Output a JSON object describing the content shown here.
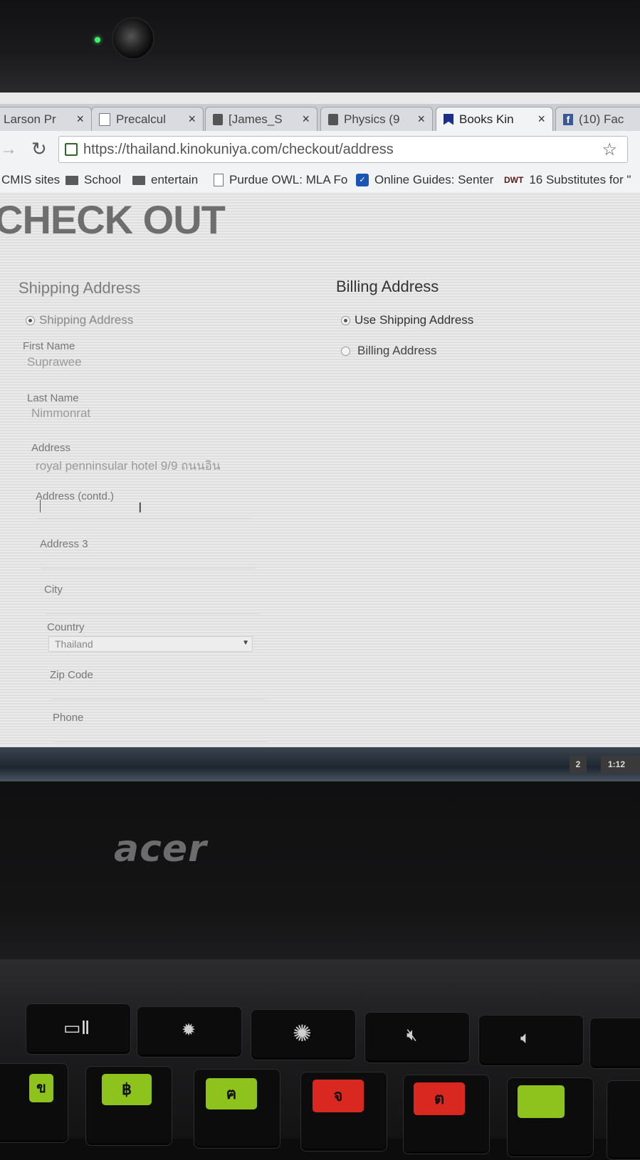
{
  "browser": {
    "tabs": [
      {
        "title": "Larson Pr",
        "favicon": "doc-icon",
        "active": false
      },
      {
        "title": "Precalcul",
        "favicon": "doc-icon",
        "active": false
      },
      {
        "title": "[James_S",
        "favicon": "image-icon",
        "active": false
      },
      {
        "title": "Physics (9",
        "favicon": "image-icon",
        "active": false
      },
      {
        "title": "Books Kin",
        "favicon": "bookmark-icon",
        "active": true
      },
      {
        "title": "(10) Fac",
        "favicon": "facebook-icon",
        "active": false
      }
    ],
    "tab_close_glyph": "×",
    "url": "https://thailand.kinokuniya.com/checkout/address",
    "bookmarks": [
      {
        "label": "CMIS sites",
        "icon": "none"
      },
      {
        "label": "School",
        "icon": "folder-icon"
      },
      {
        "label": "entertain",
        "icon": "folder-icon"
      },
      {
        "label": "Purdue OWL: MLA Fo",
        "icon": "doc-icon"
      },
      {
        "label": "Online Guides: Senter",
        "icon": "guide-icon"
      },
      {
        "label": "16 Substitutes for \"",
        "icon": "dwt-icon",
        "icon_text": "DWT"
      }
    ]
  },
  "checkout": {
    "title": "CHECK OUT",
    "shipping": {
      "heading": "Shipping Address",
      "radio_label": "Shipping Address",
      "fields": {
        "first_name_label": "First Name",
        "first_name_value": "Suprawee",
        "last_name_label": "Last Name",
        "last_name_value": "Nimmonrat",
        "address_label": "Address",
        "address_value": "royal penninsular hotel 9/9 ถนนอิน",
        "address2_label": "Address (contd.)",
        "address2_value": "",
        "address3_label": "Address 3",
        "city_label": "City",
        "country_label": "Country",
        "country_value": "Thailand",
        "zip_label": "Zip Code",
        "phone_label": "Phone"
      }
    },
    "billing": {
      "heading": "Billing Address",
      "options": [
        {
          "label": "Use Shipping Address",
          "selected": true
        },
        {
          "label": "Billing Address",
          "selected": false
        }
      ]
    }
  },
  "shelf": {
    "badge": "2",
    "time": "1:12"
  },
  "device": {
    "brand": "acer"
  },
  "keyboard": {
    "row1": [
      "window-switch-icon",
      "brightness-down-icon",
      "brightness-up-icon",
      "mute-icon",
      "volume-down-icon"
    ],
    "row2_stickers": [
      "ข",
      "฿",
      "ฅ",
      "จ",
      "ต"
    ]
  },
  "colors": {
    "page_background": "#e6e6e6",
    "heading_text": "#333333",
    "muted_text": "#7d7d7d",
    "link_blue": "#1a55b5",
    "sticker_green": "#8ec21c",
    "sticker_red": "#d8281f"
  }
}
